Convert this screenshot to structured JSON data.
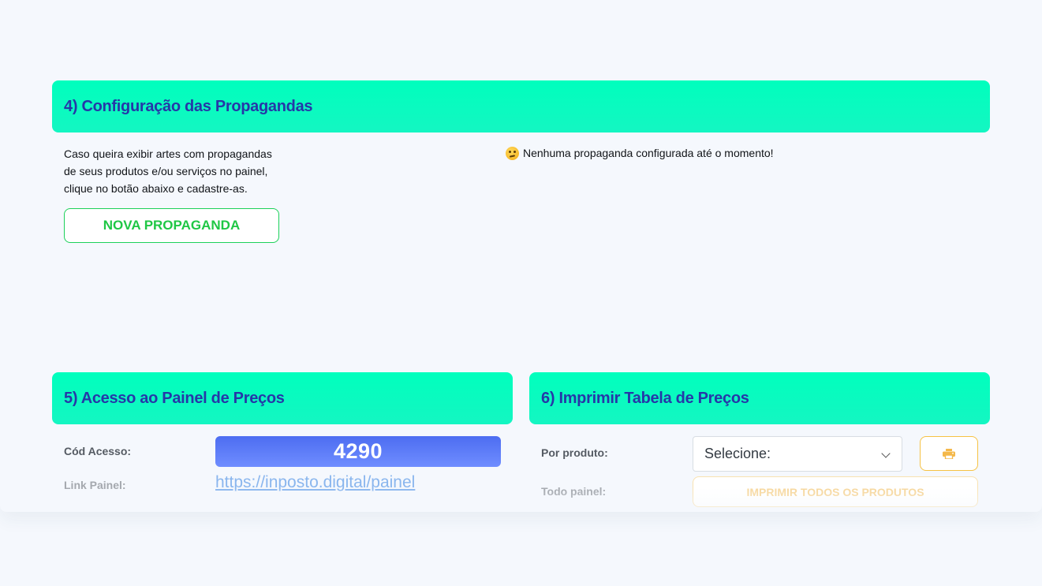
{
  "section4": {
    "title": "4) Configuração das Propagandas",
    "description_lines": [
      "Caso queira exibir artes com propagandas",
      "de seus produtos e/ou serviços no painel,",
      "clique no botão abaixo e cadastre-as."
    ],
    "new_button_label": "NOVA PROPAGANDA",
    "empty_icon": "face-with-raised-eyebrow-icon",
    "empty_message": "Nenhuma propaganda configurada até o momento!"
  },
  "section5": {
    "title": "5) Acesso ao Painel de Preços",
    "code_label": "Cód Acesso:",
    "code_value": "4290",
    "link_label": "Link Painel:",
    "link_value": "https://inposto.digital/painel"
  },
  "section6": {
    "title": "6) Imprimir Tabela de Preços",
    "by_product_label": "Por produto:",
    "select_value": "Selecione:",
    "print_icon": "printer-icon",
    "all_label": "Todo painel:",
    "print_all_button": "IMPRIMIR TODOS OS PRODUTOS"
  },
  "colors": {
    "header_bg": "#00ffbd",
    "header_text": "#2637a8",
    "success_green": "#1fc745",
    "code_blue": "#4d6df1",
    "link_blue": "#8ab6ee",
    "print_orange": "#f6c244"
  }
}
